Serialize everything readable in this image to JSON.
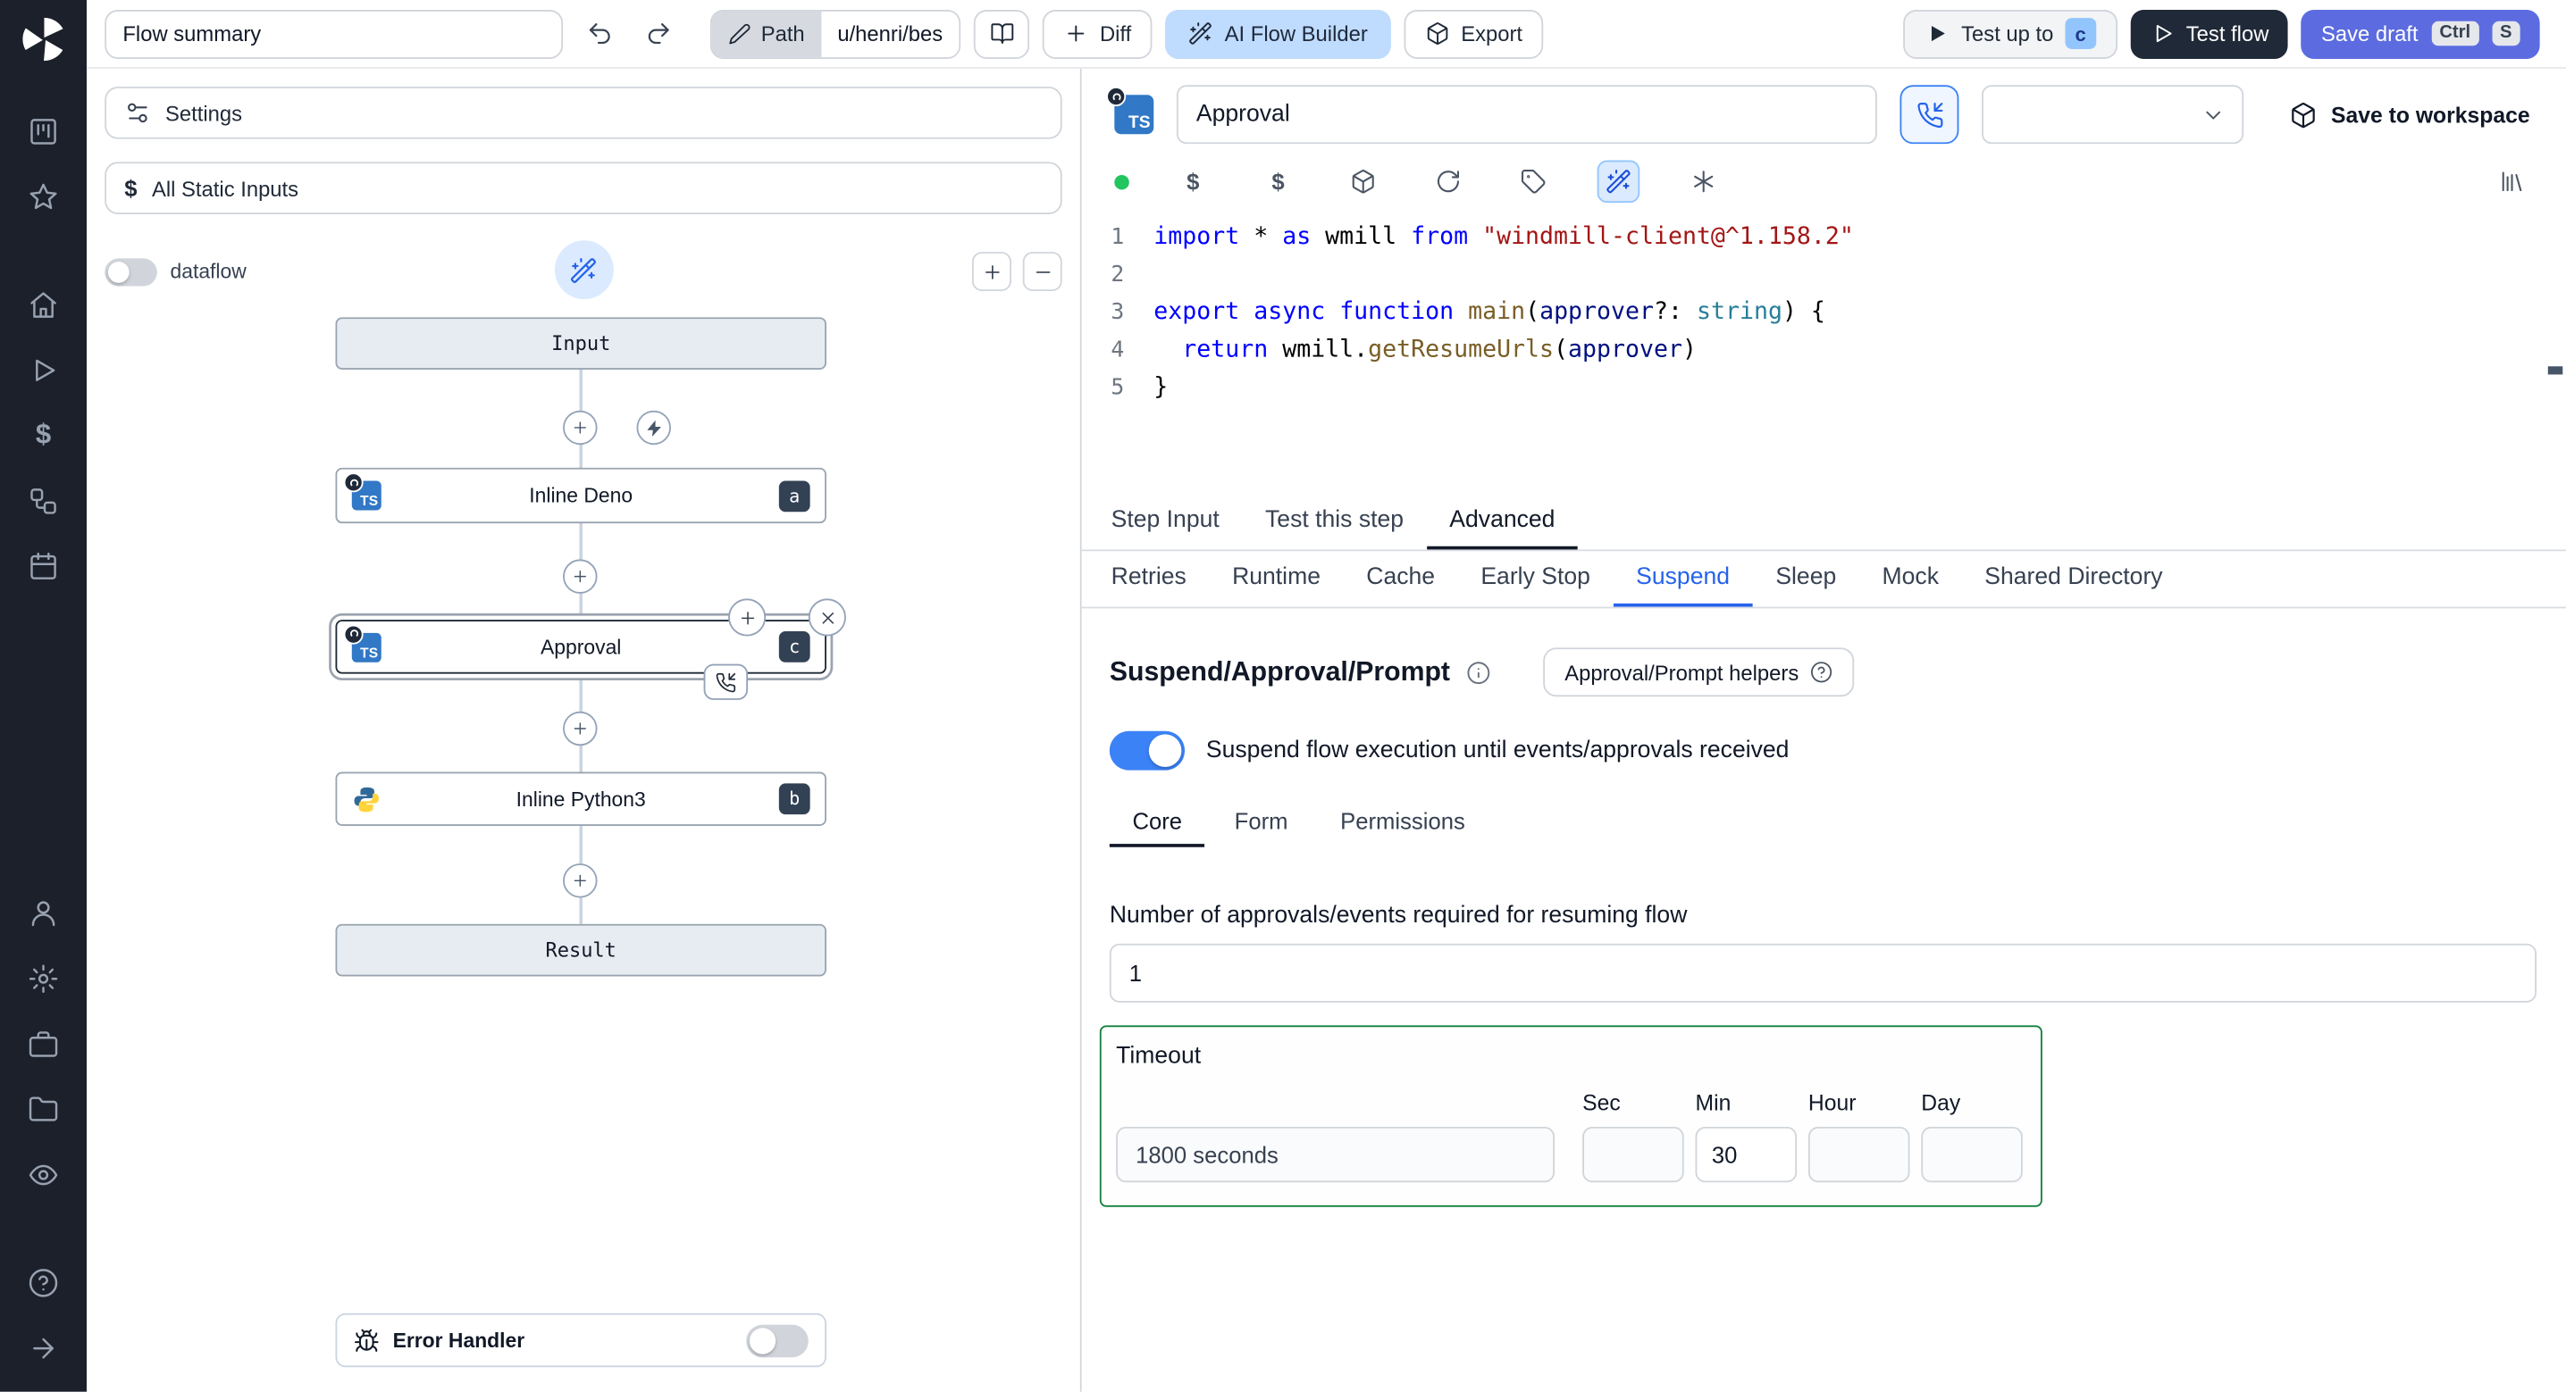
{
  "topbar": {
    "flow_summary_value": "Flow summary",
    "path_label": "Path",
    "path_value": "u/henri/bes",
    "diff_label": "Diff",
    "ai_flow_builder_label": "AI Flow Builder",
    "export_label": "Export",
    "test_up_to_label": "Test up to",
    "test_up_to_badge": "c",
    "test_flow_label": "Test flow",
    "save_draft_label": "Save draft",
    "save_draft_shortcut": [
      "Ctrl",
      "S"
    ]
  },
  "left_panel": {
    "settings_label": "Settings",
    "all_static_inputs_label": "All Static Inputs",
    "dataflow_label": "dataflow",
    "error_handler_label": "Error Handler"
  },
  "graph": {
    "input_label": "Input",
    "result_label": "Result",
    "steps": [
      {
        "label": "Inline Deno",
        "badge": "a",
        "language": "typescript"
      },
      {
        "label": "Approval",
        "badge": "c",
        "language": "typescript",
        "selected": true
      },
      {
        "label": "Inline Python3",
        "badge": "b",
        "language": "python"
      }
    ]
  },
  "step_editor": {
    "name_value": "Approval",
    "save_to_workspace_label": "Save to workspace",
    "code": {
      "lines": [
        {
          "n": "1",
          "tokens": [
            [
              "import ",
              "kw"
            ],
            [
              "* ",
              "pl"
            ],
            [
              "as",
              "kw"
            ],
            [
              " wmill ",
              "pl"
            ],
            [
              "from",
              "kw"
            ],
            [
              " ",
              "pl"
            ],
            [
              "\"windmill-client@^1.158.2\"",
              "str"
            ]
          ]
        },
        {
          "n": "2",
          "tokens": []
        },
        {
          "n": "3",
          "tokens": [
            [
              "export",
              "kw"
            ],
            [
              " ",
              "pl"
            ],
            [
              "async",
              "kw"
            ],
            [
              " ",
              "pl"
            ],
            [
              "function",
              "kw"
            ],
            [
              " ",
              "pl"
            ],
            [
              "main",
              "fn"
            ],
            [
              "(",
              "pl"
            ],
            [
              "approver",
              "var"
            ],
            [
              "?: ",
              "pl"
            ],
            [
              "string",
              "type"
            ],
            [
              ") {",
              "pl"
            ]
          ]
        },
        {
          "n": "4",
          "tokens": [
            [
              "  ",
              "pl"
            ],
            [
              "return",
              "kw"
            ],
            [
              " wmill.",
              "pl"
            ],
            [
              "getResumeUrls",
              "fn"
            ],
            [
              "(",
              "pl"
            ],
            [
              "approver",
              "var"
            ],
            [
              ")",
              "pl"
            ]
          ]
        },
        {
          "n": "5",
          "tokens": [
            [
              "}",
              "pl"
            ]
          ]
        }
      ]
    },
    "tabs": [
      {
        "label": "Step Input"
      },
      {
        "label": "Test this step"
      },
      {
        "label": "Advanced"
      }
    ],
    "advanced_tabs": [
      {
        "label": "Retries"
      },
      {
        "label": "Runtime"
      },
      {
        "label": "Cache"
      },
      {
        "label": "Early Stop"
      },
      {
        "label": "Suspend"
      },
      {
        "label": "Sleep"
      },
      {
        "label": "Mock"
      },
      {
        "label": "Shared Directory"
      }
    ]
  },
  "suspend": {
    "title": "Suspend/Approval/Prompt",
    "helpers_button_label": "Approval/Prompt helpers",
    "toggle_label": "Suspend flow execution until events/approvals received",
    "tabs": [
      {
        "label": "Core"
      },
      {
        "label": "Form"
      },
      {
        "label": "Permissions"
      }
    ],
    "approvals_label": "Number of approvals/events required for resuming flow",
    "approvals_value": "1",
    "timeout": {
      "label": "Timeout",
      "summary_value": "1800 seconds",
      "fields": [
        {
          "label": "Sec",
          "value": ""
        },
        {
          "label": "Min",
          "value": "30"
        },
        {
          "label": "Hour",
          "value": ""
        },
        {
          "label": "Day",
          "value": ""
        }
      ]
    }
  },
  "colors": {
    "accent_blue": "#3b82f6",
    "suspend_tab": "#2563eb",
    "green_dot": "#22c55e",
    "timeout_border": "#15803d",
    "save_draft_bg": "#5c6ce0",
    "test_flow_bg": "#1f2937",
    "ai_builder_bg": "#bfdbfe",
    "badge_bg": "#334155",
    "ts_blue": "#3178c6",
    "rail_bg": "#1b202b",
    "code_keyword": "#0000ff",
    "code_string": "#a31515",
    "code_function": "#795e26",
    "code_variable": "#001080",
    "code_type": "#267f99"
  }
}
